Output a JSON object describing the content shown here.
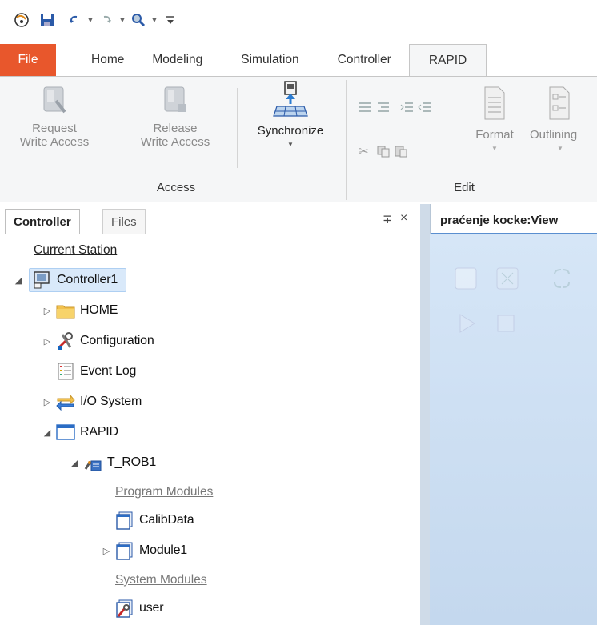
{
  "quick_access": {
    "icons": [
      "logo-icon",
      "save-icon",
      "undo-icon",
      "redo-icon",
      "zoom-icon",
      "customize-icon"
    ]
  },
  "ribbon_tabs": [
    "File",
    "Home",
    "Modeling",
    "Simulation",
    "Controller",
    "RAPID"
  ],
  "ribbon": {
    "request_write_access": [
      "Request",
      "Write Access"
    ],
    "release_write_access": [
      "Release",
      "Write Access"
    ],
    "synchronize": "Synchronize",
    "access_group": "Access",
    "edit_group": "Edit",
    "format": "Format",
    "outlining": "Outlining"
  },
  "panel": {
    "tabs": [
      "Controller",
      "Files"
    ],
    "pin_glyph": "∓",
    "close_glyph": "×"
  },
  "tree": {
    "current_station": "Current Station",
    "controller": "Controller1",
    "home": "HOME",
    "configuration": "Configuration",
    "event_log": "Event Log",
    "io_system": "I/O System",
    "rapid": "RAPID",
    "task": "T_ROB1",
    "program_modules": "Program Modules",
    "calib_data": "CalibData",
    "module1": "Module1",
    "system_modules": "System Modules",
    "user": "user"
  },
  "view": {
    "tab_title": "praćenje kocke:View"
  },
  "colors": {
    "file_tab": "#e8572c",
    "view_background": "#c9dcf0",
    "selection": "#d9e9fa"
  }
}
